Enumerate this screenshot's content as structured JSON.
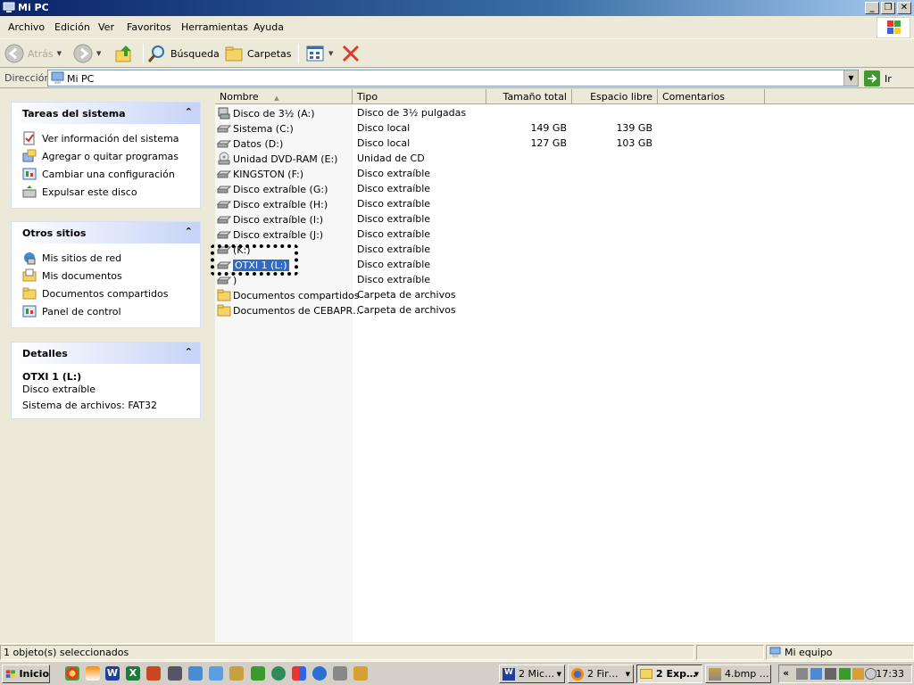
{
  "window": {
    "title": "Mi PC"
  },
  "menu": [
    "Archivo",
    "Edición",
    "Ver",
    "Favoritos",
    "Herramientas",
    "Ayuda"
  ],
  "toolbar": {
    "back": "Atrás",
    "search": "Búsqueda",
    "folders": "Carpetas"
  },
  "address": {
    "label": "Dirección",
    "value": "Mi PC",
    "go": "Ir"
  },
  "taskpane": {
    "system": {
      "title": "Tareas del sistema",
      "items": [
        "Ver información del sistema",
        "Agregar o quitar programas",
        "Cambiar una configuración",
        "Expulsar este disco"
      ]
    },
    "places": {
      "title": "Otros sitios",
      "items": [
        "Mis sitios de red",
        "Mis documentos",
        "Documentos compartidos",
        "Panel de control"
      ]
    },
    "details": {
      "title": "Detalles",
      "name": "OTXI 1 (L:)",
      "type": "Disco extraíble",
      "fs": "Sistema de archivos: FAT32"
    }
  },
  "columns": [
    "Nombre",
    "Tipo",
    "Tamaño total",
    "Espacio libre",
    "Comentarios"
  ],
  "rows": [
    {
      "name": "Disco de 3½ (A:)",
      "type": "Disco de 3½ pulgadas",
      "total": "",
      "free": "",
      "icon": "floppy-drive-icon"
    },
    {
      "name": "Sistema (C:)",
      "type": "Disco local",
      "total": "149 GB",
      "free": "139 GB",
      "icon": "hard-drive-icon"
    },
    {
      "name": "Datos (D:)",
      "type": "Disco local",
      "total": "127 GB",
      "free": "103 GB",
      "icon": "hard-drive-icon"
    },
    {
      "name": "Unidad DVD-RAM (E:)",
      "type": "Unidad de CD",
      "total": "",
      "free": "",
      "icon": "dvd-drive-icon"
    },
    {
      "name": "KINGSTON (F:)",
      "type": "Disco extraíble",
      "total": "",
      "free": "",
      "icon": "removable-drive-icon"
    },
    {
      "name": "Disco extraíble (G:)",
      "type": "Disco extraíble",
      "total": "",
      "free": "",
      "icon": "removable-drive-icon"
    },
    {
      "name": "Disco extraíble (H:)",
      "type": "Disco extraíble",
      "total": "",
      "free": "",
      "icon": "removable-drive-icon"
    },
    {
      "name": "Disco extraíble (I:)",
      "type": "Disco extraíble",
      "total": "",
      "free": "",
      "icon": "removable-drive-icon"
    },
    {
      "name": "Disco extraíble (J:)",
      "type": "Disco extraíble",
      "total": "",
      "free": "",
      "icon": "removable-drive-icon"
    },
    {
      "name": "(K:)",
      "type": "Disco extraíble",
      "total": "",
      "free": "",
      "icon": "removable-drive-icon"
    },
    {
      "name": "OTXI 1 (L:)",
      "type": "Disco extraíble",
      "total": "",
      "free": "",
      "icon": "removable-drive-icon",
      "selected": true
    },
    {
      "name": ")",
      "type": "Disco extraíble",
      "total": "",
      "free": "",
      "icon": "removable-drive-icon"
    },
    {
      "name": "Documentos compartidos",
      "type": "Carpeta de archivos",
      "total": "",
      "free": "",
      "icon": "folder-icon"
    },
    {
      "name": "Documentos de CEBAPR…",
      "type": "Carpeta de archivos",
      "total": "",
      "free": "",
      "icon": "folder-icon"
    }
  ],
  "status": {
    "left": "1 objeto(s) seleccionados",
    "right": "Mi equipo"
  },
  "taskbar": {
    "start": "Inicio",
    "buttons": [
      "2 Mic…",
      "2 Fir…",
      "2 Exp…",
      "4.bmp …"
    ],
    "clock": "17:33"
  }
}
